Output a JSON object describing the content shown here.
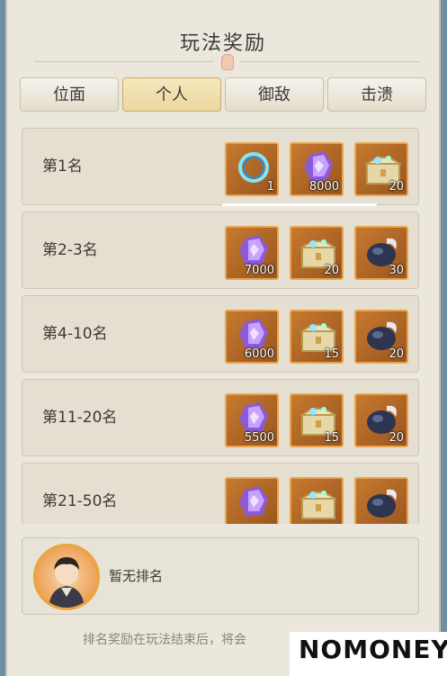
{
  "dialog": {
    "title": "玩法奖励"
  },
  "tabs": [
    {
      "label": "位面",
      "active": false
    },
    {
      "label": "个人",
      "active": true
    },
    {
      "label": "御敌",
      "active": false
    },
    {
      "label": "击溃",
      "active": false
    }
  ],
  "rewards": [
    {
      "rank": "第1名",
      "items": [
        {
          "icon": "ring-portal-icon",
          "qty": "1"
        },
        {
          "icon": "purple-crystal-icon",
          "qty": "8000"
        },
        {
          "icon": "treasure-chest-icon",
          "qty": "20"
        }
      ]
    },
    {
      "rank": "第2-3名",
      "items": [
        {
          "icon": "purple-crystal-icon",
          "qty": "7000"
        },
        {
          "icon": "treasure-chest-icon",
          "qty": "20"
        },
        {
          "icon": "dark-orb-icon",
          "qty": "30"
        }
      ]
    },
    {
      "rank": "第4-10名",
      "items": [
        {
          "icon": "purple-crystal-icon",
          "qty": "6000"
        },
        {
          "icon": "treasure-chest-icon",
          "qty": "15"
        },
        {
          "icon": "dark-orb-icon",
          "qty": "20"
        }
      ]
    },
    {
      "rank": "第11-20名",
      "items": [
        {
          "icon": "purple-crystal-icon",
          "qty": "5500"
        },
        {
          "icon": "treasure-chest-icon",
          "qty": "15"
        },
        {
          "icon": "dark-orb-icon",
          "qty": "20"
        }
      ]
    },
    {
      "rank": "第21-50名",
      "items": [
        {
          "icon": "purple-crystal-icon",
          "qty": ""
        },
        {
          "icon": "treasure-chest-icon",
          "qty": ""
        },
        {
          "icon": "dark-orb-icon",
          "qty": ""
        }
      ]
    }
  ],
  "self": {
    "status": "暂无排名"
  },
  "footer": {
    "note": "排名奖励在玩法结束后，将会"
  },
  "watermark": {
    "text": "NOMONEY"
  },
  "colors": {
    "item_bg": "#c67a2e",
    "item_border": "#e9a44b",
    "active_tab": "#ead7a0"
  }
}
